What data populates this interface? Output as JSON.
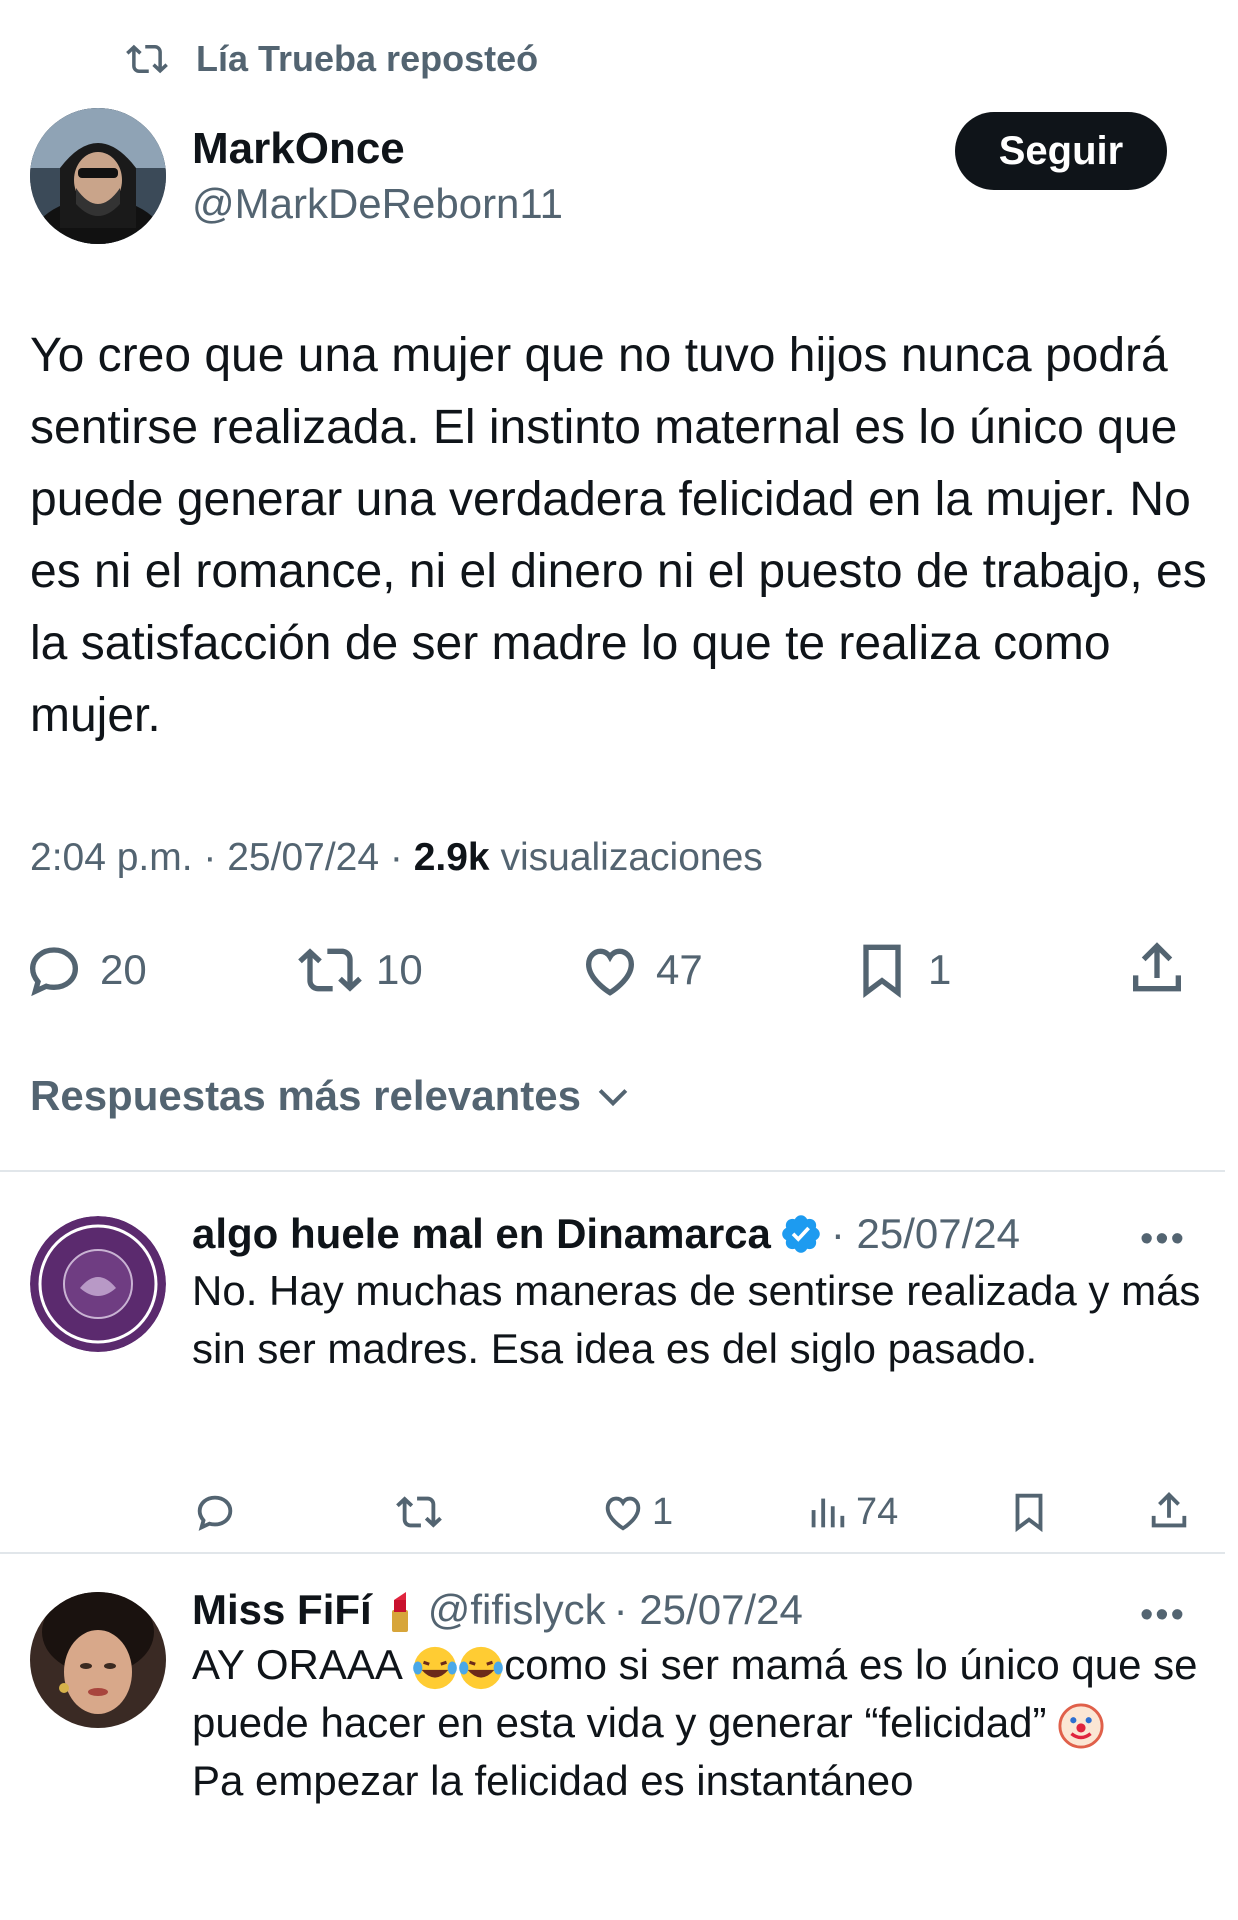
{
  "repost": {
    "text": "Lía Trueba reposteó",
    "icon": "repost-icon"
  },
  "author": {
    "name": "MarkOnce",
    "handle": "@MarkDeReborn11",
    "follow_label": "Seguir"
  },
  "tweet": {
    "text": "Yo creo que una mujer que no tuvo hijos nunca podrá sentirse realizada. El instinto maternal es lo único que puede generar una verdadera felicidad en la mujer. No es ni el romance, ni el dinero ni el puesto de trabajo, es la satisfacción de ser madre lo que te realiza como mujer.",
    "time": "2:04 p.m. · 25/07/24 · ",
    "views_count": "2.9k",
    "views_label": " visualizaciones"
  },
  "actions": {
    "replies": "20",
    "reposts": "10",
    "likes": "47",
    "bookmarks": "1"
  },
  "sort": {
    "label": "Respuestas más relevantes"
  },
  "replies": [
    {
      "name": "algo huele mal en Dinamarca",
      "verified": true,
      "date": "· 25/07/24",
      "more": "•••",
      "text": "No.  Hay muchas maneras de sentirse realizada y más sin ser madres.   Esa idea es del siglo pasado.",
      "likes": "1",
      "views": "74"
    },
    {
      "name": "Miss FiFí",
      "handle": "@fifislyck",
      "date": "· 25/07/24",
      "more": "•••",
      "text_1": "AY ORAAA ",
      "text_2": "como si ser mamá es lo único que se puede hacer en esta vida  y generar “felicidad” ",
      "text_3": "Pa empezar la felicidad es instantáneo"
    }
  ],
  "colors": {
    "text": "#0f1419",
    "secondary": "#536471",
    "verified": "#1d9bf0",
    "divider": "#e1e6ea"
  }
}
